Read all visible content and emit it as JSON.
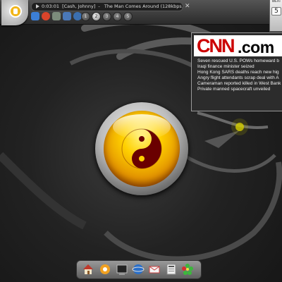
{
  "media_player": {
    "time": "0:03:01",
    "artist": "[Cash, Johnny]",
    "separator": "-",
    "track": "The Man Comes Around (128kbps)"
  },
  "desktops": [
    "1",
    "2",
    "3",
    "4",
    "5"
  ],
  "weather": {
    "label": "WEAT",
    "value": "5"
  },
  "news": {
    "logo_text": "CNN",
    "logo_suffix": ".com",
    "headlines": [
      "Seven rescued U.S. POWs homeward b",
      "Iraqi finance minister seized",
      "Hong Kong SARS deaths reach new hig",
      "Angry flight attendants scrap deal with A",
      "Cameraman reported killed in West Bank",
      "Private manned spacecraft unveiled"
    ]
  },
  "colors": {
    "cnn_red": "#cc0000",
    "orb_gold": "#ffd000",
    "yin_dark": "#6a0000"
  },
  "dock_icons": [
    "home-icon",
    "settings-icon",
    "terminal-icon",
    "network-icon",
    "mail-icon",
    "news-icon",
    "icq-flower-icon"
  ]
}
